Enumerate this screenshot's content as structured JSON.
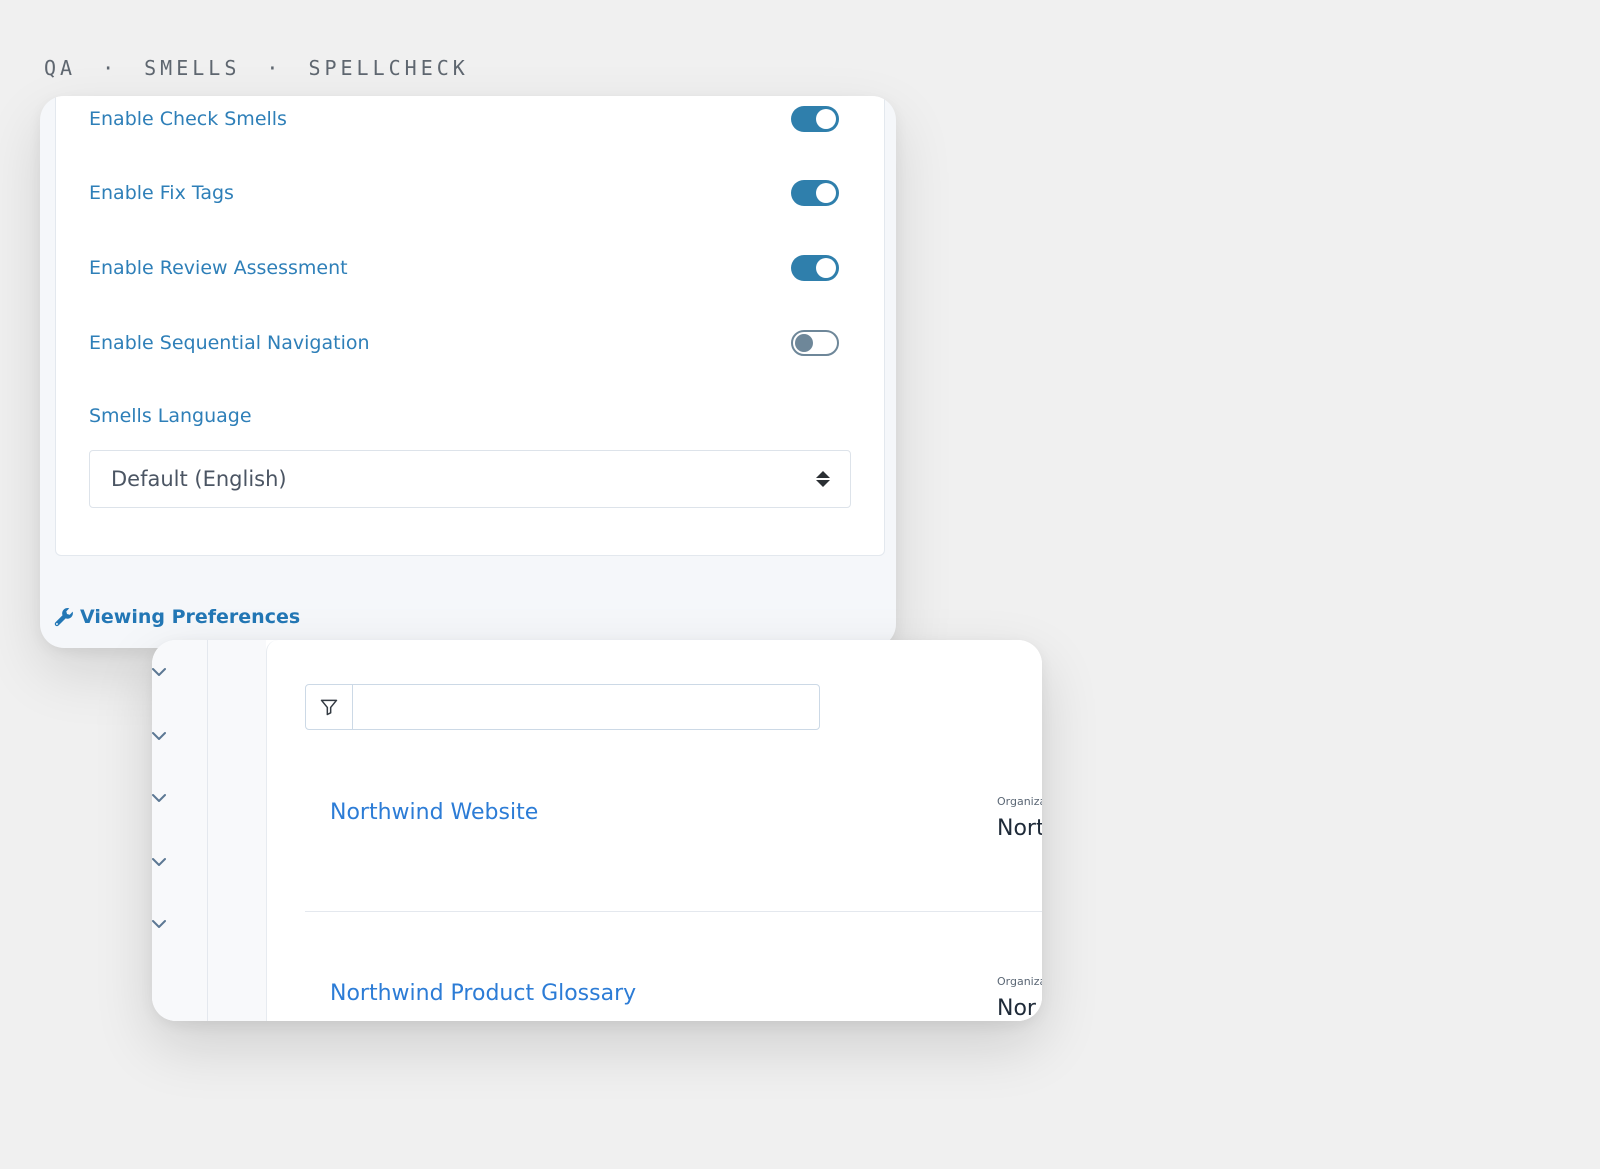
{
  "breadcrumb": {
    "items": [
      "QA",
      "SMELLS",
      "SPELLCHECK"
    ],
    "separator": "·"
  },
  "settings": {
    "toggles": [
      {
        "label": "Enable Check Smells",
        "on": true
      },
      {
        "label": "Enable Fix Tags",
        "on": true
      },
      {
        "label": "Enable Review Assessment",
        "on": true
      },
      {
        "label": "Enable Sequential Navigation",
        "on": false
      }
    ],
    "language": {
      "label": "Smells Language",
      "value": "Default (English)"
    },
    "viewing_preferences_label": "Viewing Preferences"
  },
  "projects": {
    "filter": {
      "value": "",
      "placeholder": ""
    },
    "rows": [
      {
        "name": "Northwind Website",
        "org_label": "Organiza",
        "org_value": "Nort"
      },
      {
        "name": "Northwind Product Glossary",
        "org_label": "Organiza",
        "org_value": "Nor"
      }
    ]
  },
  "colors": {
    "accent": "#2e7fb8",
    "toggle_on": "#2f7fac",
    "link": "#2c7cd6",
    "background": "#f0f0f0"
  },
  "icons": {
    "viewing_preferences": "wrench-icon",
    "filter": "filter-icon",
    "sidebar_expand": "chevron-down-icon",
    "language_select": "sort-updown-icon"
  }
}
